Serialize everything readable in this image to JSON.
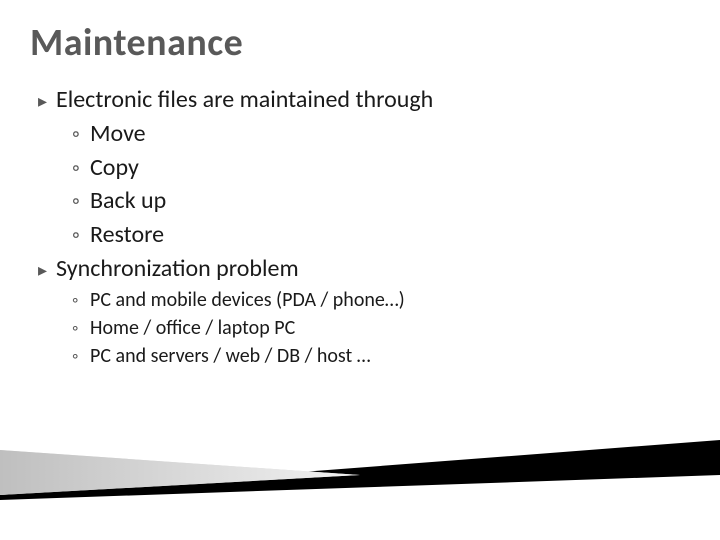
{
  "title": "Maintenance",
  "items": [
    {
      "text": "Electronic files are maintained through",
      "children": [
        {
          "text": "Move"
        },
        {
          "text": "Copy"
        },
        {
          "text": "Back up"
        },
        {
          "text": "Restore"
        }
      ]
    },
    {
      "text": "Synchronization problem",
      "children": [
        {
          "text": "PC and mobile devices (PDA / phone…)"
        },
        {
          "text": "Home / office / laptop PC"
        },
        {
          "text": "PC and servers / web / DB / host …"
        }
      ]
    }
  ],
  "bullet_l1": "▸",
  "bullet_l2": "◦"
}
